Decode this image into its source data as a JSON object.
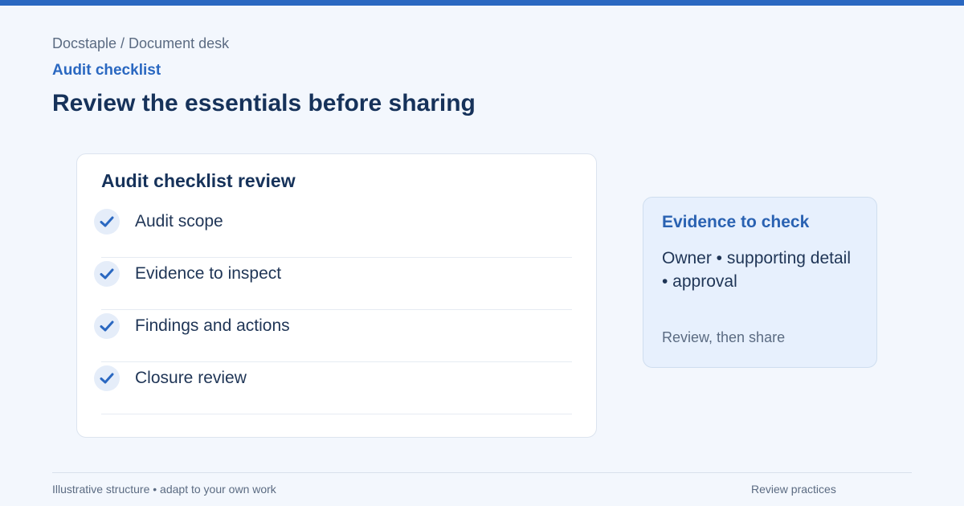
{
  "header": {
    "breadcrumb": "Docstaple / Document desk",
    "eyebrow": "Audit checklist",
    "title": "Review the essentials before sharing"
  },
  "checklist": {
    "title": "Audit checklist review",
    "items": [
      {
        "label": "Audit scope",
        "icon": "check-icon"
      },
      {
        "label": "Evidence to inspect",
        "icon": "check-icon"
      },
      {
        "label": "Findings and actions",
        "icon": "check-icon"
      },
      {
        "label": "Closure review",
        "icon": "check-icon"
      }
    ]
  },
  "evidence": {
    "title": "Evidence to check",
    "body": "Owner • supporting detail • approval",
    "note": "Review, then share"
  },
  "footer": {
    "left": "Illustrative structure • adapt to your own work",
    "right": "Review practices"
  },
  "colors": {
    "accent": "#2a68c1",
    "background": "#f3f7fd",
    "card": "#ffffff",
    "evidence_card": "#e7f0fd",
    "heading": "#16325a",
    "muted": "#5b6b82"
  }
}
